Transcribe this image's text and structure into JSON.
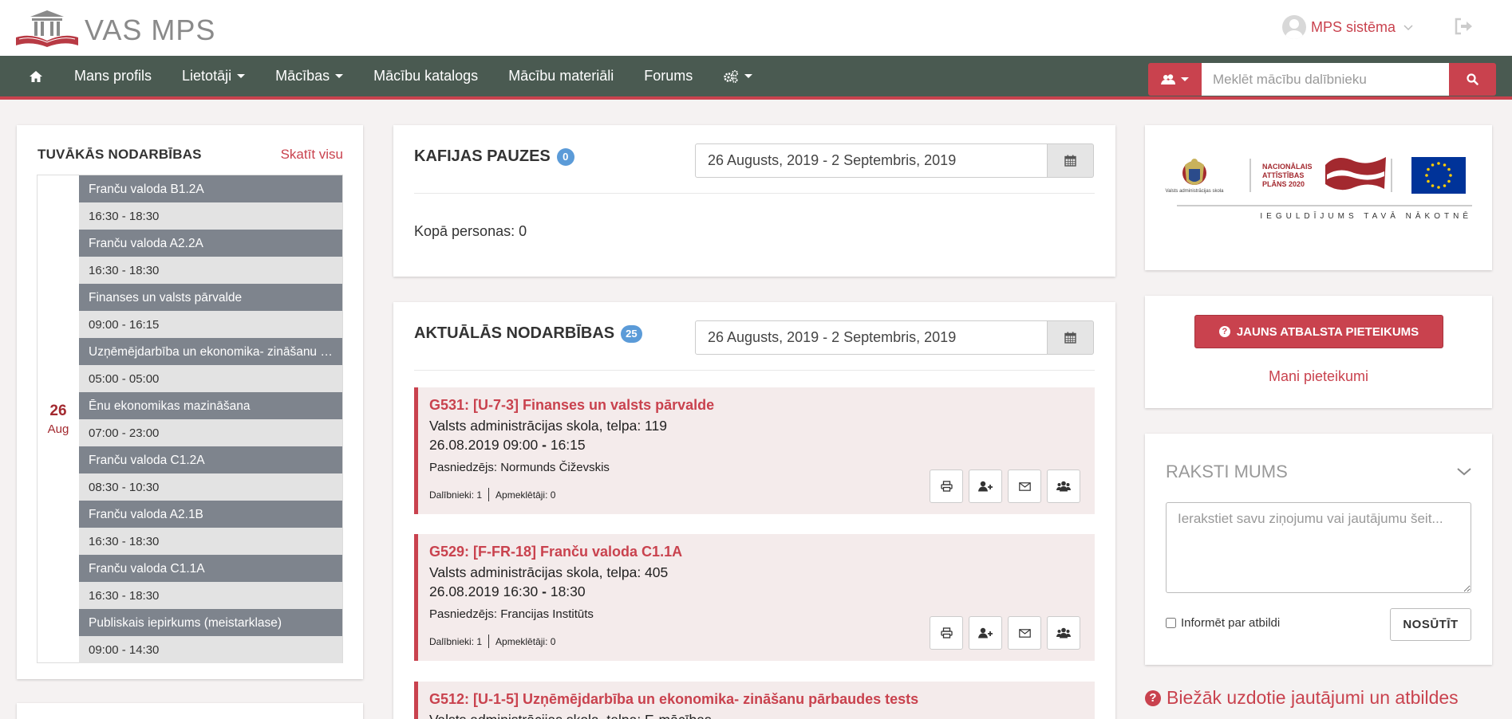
{
  "header": {
    "logo_text": "VAS MPS",
    "user_name": "MPS sistēma"
  },
  "nav": {
    "items": [
      {
        "label": "Mans profils",
        "dropdown": false
      },
      {
        "label": "Lietotāji",
        "dropdown": true
      },
      {
        "label": "Mācības",
        "dropdown": true
      },
      {
        "label": "Mācību katalogs",
        "dropdown": false
      },
      {
        "label": "Mācību materiāli",
        "dropdown": false
      },
      {
        "label": "Forums",
        "dropdown": false
      }
    ],
    "search_placeholder": "Meklēt mācību dalībnieku"
  },
  "upcoming": {
    "title": "TUVĀKĀS NODARBĪBAS",
    "view_all": "Skatīt visu",
    "day": "26",
    "month": "Aug",
    "items": [
      {
        "name": "Franču valoda B1.2A",
        "time": "16:30 - 18:30"
      },
      {
        "name": "Franču valoda A2.2A",
        "time": "16:30 - 18:30"
      },
      {
        "name": "Finanses un valsts pārvalde",
        "time": "09:00 - 16:15"
      },
      {
        "name": "Uzņēmējdarbība un ekonomika- zināšanu pārbaudes tests",
        "time": "05:00 - 05:00"
      },
      {
        "name": "Ēnu ekonomikas mazināšana",
        "time": "07:00 - 23:00"
      },
      {
        "name": "Franču valoda C1.2A",
        "time": "08:30 - 10:30"
      },
      {
        "name": "Franču valoda A2.1B",
        "time": "16:30 - 18:30"
      },
      {
        "name": "Franču valoda C1.1A",
        "time": "16:30 - 18:30"
      },
      {
        "name": "Publiskais iepirkums (meistarklase)",
        "time": "09:00 - 14:30"
      }
    ]
  },
  "coffee": {
    "title": "KAFIJAS PAUZES",
    "count": "0",
    "date_range": "26 Augusts, 2019 - 2 Septembris, 2019",
    "total": "Kopā personas: 0"
  },
  "activities": {
    "title": "AKTUĀLĀS NODARBĪBAS",
    "count": "25",
    "date_range": "26 Augusts, 2019 - 2 Septembris, 2019",
    "items": [
      {
        "title": "G531: [U-7-3] Finanses un valsts pārvalde",
        "location": "Valsts administrācijas skola, telpa: 119",
        "date": "26.08.2019",
        "start": "09:00",
        "end": "16:15",
        "lecturer": "Pasniedzējs: Normunds Čiževskis",
        "participants": "Dalībnieki: 1",
        "attendees": "Apmeklētāji: 0"
      },
      {
        "title": "G529: [F-FR-18] Franču valoda C1.1A",
        "location": "Valsts administrācijas skola, telpa: 405",
        "date": "26.08.2019",
        "start": "16:30",
        "end": "18:30",
        "lecturer": "Pasniedzējs: Francijas Institūts",
        "participants": "Dalībnieki: 1",
        "attendees": "Apmeklētāji: 0"
      },
      {
        "title": "G512: [U-1-5] Uzņēmējdarbība un ekonomika- zināšanu pārbaudes tests",
        "location": "Valsts administrācijas skola, telpa: E-mācības"
      }
    ]
  },
  "sponsor": {
    "vas_caption": "Valsts administrācijas skola",
    "nap_line1": "NACIONĀLAIS",
    "nap_line2": "ATTĪSTĪBAS",
    "nap_line3": "PLĀNS 2020",
    "slogan": "IEGULDĪJUMS TAVĀ NĀKOTNĒ"
  },
  "support": {
    "button": "JAUNS ATBALSTA PIETEIKUMS",
    "link": "Mani pieteikumi"
  },
  "write": {
    "title": "RAKSTI MUMS",
    "placeholder": "Ierakstiet savu ziņojumu vai jautājumu šeit...",
    "inform_label": "Informēt par atbildi",
    "send": "NOSŪTĪT"
  },
  "faq": {
    "label": "Biežāk uzdotie jautājumi un atbildes"
  },
  "colors": {
    "accent": "#c9424e",
    "navbar": "#4a5a51",
    "badge": "#5b9bd8",
    "schedule_header": "#7e848d"
  }
}
